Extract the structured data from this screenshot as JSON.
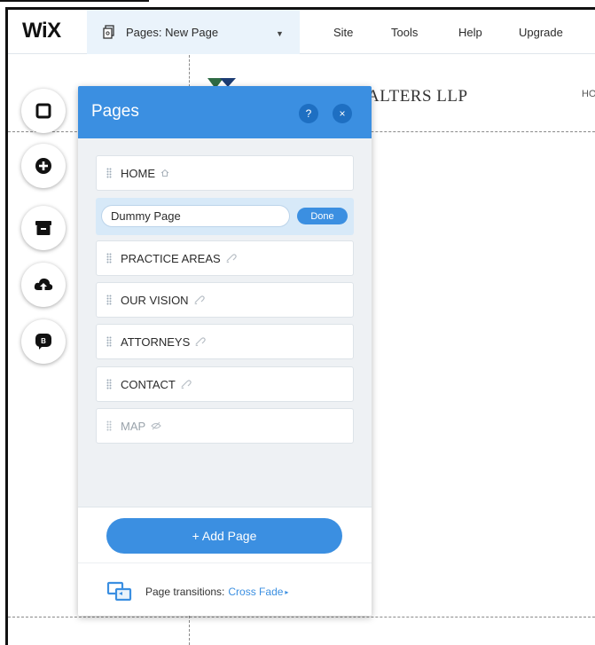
{
  "topbar": {
    "logo": "WiX",
    "current_page_label": "Pages: New Page",
    "menu": [
      "Site",
      "Tools",
      "Help",
      "Upgrade"
    ]
  },
  "site": {
    "header_title": "ALTERS LLP",
    "nav_fragment": "HO"
  },
  "tools": [
    "page-layout-icon",
    "add-icon",
    "media-archive-icon",
    "upload-icon",
    "blog-chat-icon"
  ],
  "panel": {
    "title": "Pages",
    "help_label": "?",
    "close_label": "×",
    "pages": [
      {
        "label": "HOME",
        "icon": "home-icon",
        "hidden": false,
        "editing": false
      },
      {
        "label": "Dummy Page",
        "icon": "",
        "hidden": false,
        "editing": true
      },
      {
        "label": "PRACTICE AREAS",
        "icon": "link-icon",
        "hidden": false,
        "editing": false
      },
      {
        "label": "OUR VISION",
        "icon": "link-icon",
        "hidden": false,
        "editing": false
      },
      {
        "label": "ATTORNEYS",
        "icon": "link-icon",
        "hidden": false,
        "editing": false
      },
      {
        "label": "CONTACT",
        "icon": "link-icon",
        "hidden": false,
        "editing": false
      },
      {
        "label": "MAP",
        "icon": "hidden-eye-icon",
        "hidden": true,
        "editing": false
      }
    ],
    "edit_value": "Dummy Page",
    "done_label": "Done",
    "add_page_label": "+ Add Page",
    "transitions_label": "Page transitions:",
    "transitions_value": "Cross Fade",
    "transitions_arrow": "▸"
  },
  "colors": {
    "accent": "#3b8fe1",
    "panel_bg": "#eef1f4",
    "topbar_selected_bg": "#eaf3fb"
  }
}
